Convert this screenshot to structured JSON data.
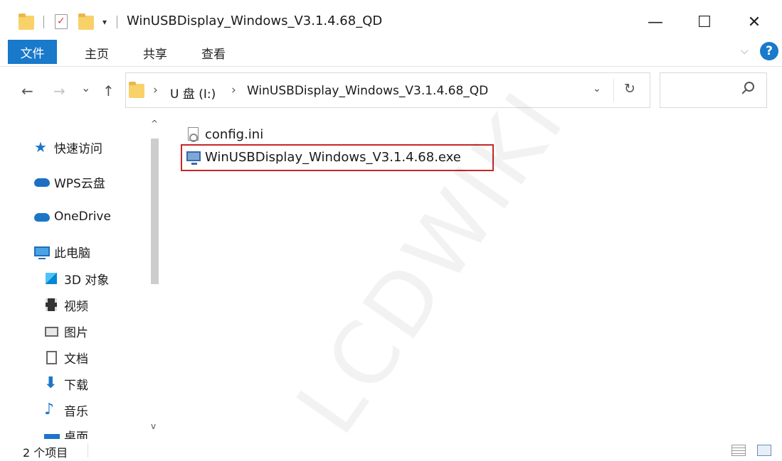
{
  "window": {
    "title": "WinUSBDisplay_Windows_V3.1.4.68_QD",
    "quick_access_dropdown": "▾",
    "minimize": "—",
    "maximize": "☐",
    "close": "✕"
  },
  "ribbon": {
    "file_tab": "文件",
    "tabs": [
      "主页",
      "共享",
      "查看"
    ],
    "collapse": "⌵",
    "help": "?"
  },
  "nav": {
    "back": "←",
    "forward": "→",
    "recent": "⌄",
    "up": "↑",
    "breadcrumbs": [
      "U 盘 (I:)",
      "WinUSBDisplay_Windows_V3.1.4.68_QD"
    ],
    "crumb_separator": "›",
    "address_dropdown": "⌄",
    "refresh": "↻",
    "search_placeholder": ""
  },
  "sidebar": {
    "items": [
      {
        "label": "快速访问",
        "icon": "star-icon"
      },
      {
        "label": "WPS云盘",
        "icon": "cloud-icon"
      },
      {
        "label": "OneDrive",
        "icon": "cloud-icon"
      },
      {
        "label": "此电脑",
        "icon": "computer-icon"
      },
      {
        "label": "3D 对象",
        "icon": "cube-icon"
      },
      {
        "label": "视频",
        "icon": "video-icon"
      },
      {
        "label": "图片",
        "icon": "picture-icon"
      },
      {
        "label": "文档",
        "icon": "document-icon"
      },
      {
        "label": "下载",
        "icon": "download-icon"
      },
      {
        "label": "音乐",
        "icon": "music-icon"
      },
      {
        "label": "桌面",
        "icon": "desktop-icon"
      }
    ],
    "scroll_up": "^",
    "scroll_down": "v"
  },
  "files": [
    {
      "name": "config.ini",
      "icon": "ini-file-icon"
    },
    {
      "name": "WinUSBDisplay_Windows_V3.1.4.68.exe",
      "icon": "exe-file-icon",
      "highlighted": true
    }
  ],
  "watermark": "LCDWIKI",
  "status": {
    "count": "2 个项目"
  },
  "colors": {
    "accent": "#1979ca",
    "highlight_border": "#c62828",
    "folder": "#f8d168"
  }
}
